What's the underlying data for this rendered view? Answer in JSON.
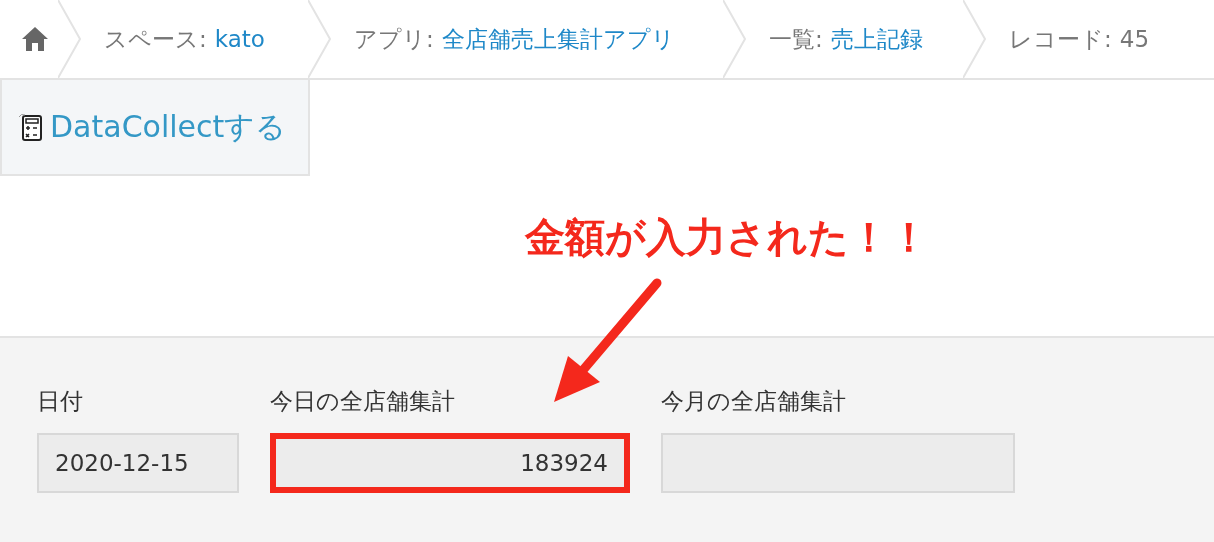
{
  "breadcrumb": [
    {
      "kind": "home"
    },
    {
      "kind": "link",
      "label": "スペース:",
      "value": "kato"
    },
    {
      "kind": "link",
      "label": "アプリ:",
      "value": "全店舗売上集計アプリ"
    },
    {
      "kind": "link",
      "label": "一覧:",
      "value": "売上記録"
    },
    {
      "kind": "text",
      "label": "レコード:",
      "value": "45"
    }
  ],
  "toolbar": {
    "button": "DataCollectする"
  },
  "annotation": {
    "text": "金額が入力された！！"
  },
  "fields": [
    {
      "label": "日付",
      "kind": "date",
      "value": "2020-12-15",
      "highlighted": false
    },
    {
      "label": "今日の全店舗集計",
      "kind": "number",
      "value": "183924",
      "highlighted": true
    },
    {
      "label": "今月の全店舗集計",
      "kind": "number",
      "highlighted": false
    }
  ]
}
